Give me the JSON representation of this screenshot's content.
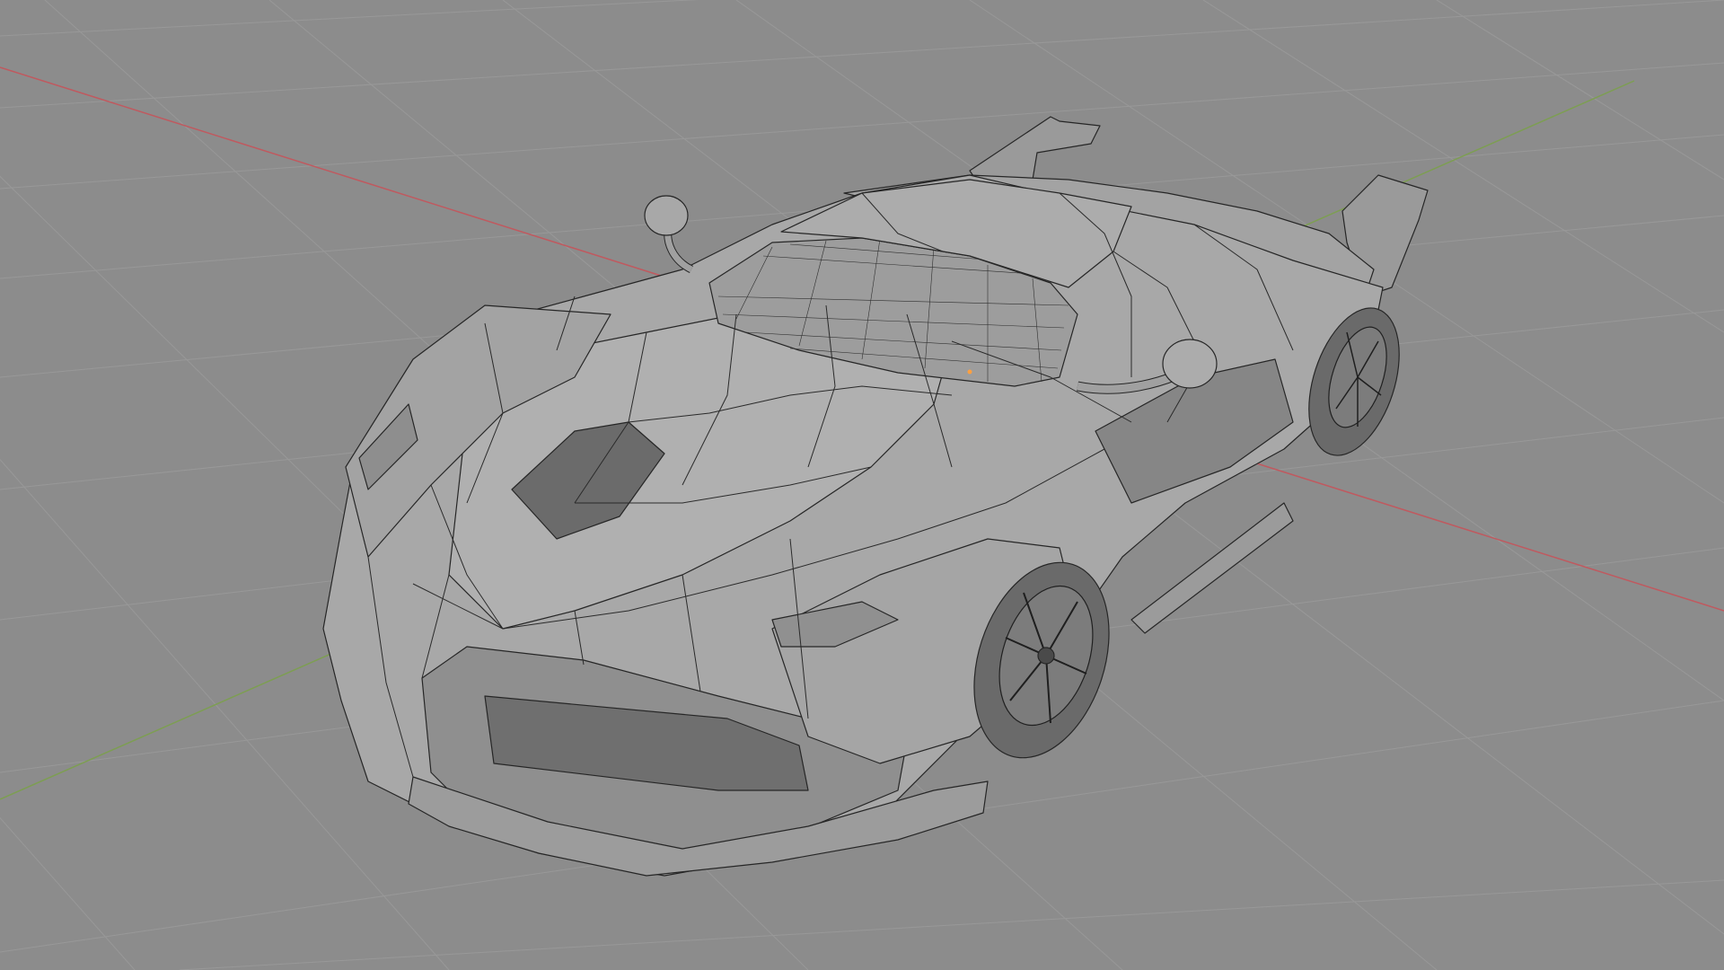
{
  "viewport": {
    "background_color": "#8c8c8c",
    "grid_color": "#9a9a9a",
    "x_axis_color": "#c0595f",
    "y_axis_color": "#7d9e52",
    "mesh_fill_color": "#a6a6a6",
    "mesh_shadow_color": "#7e7e7e",
    "wire_color": "#262626",
    "origin_color": "#ffa040"
  },
  "scene": {
    "object": "car-mesh",
    "shading": "solid-with-wireframe-overlay",
    "icons": [
      "origin-dot-icon"
    ]
  }
}
